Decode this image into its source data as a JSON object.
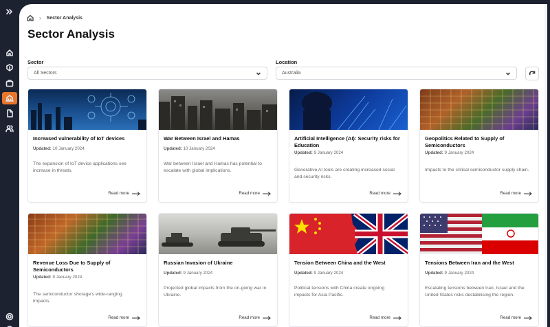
{
  "breadcrumb": {
    "current": "Sector Analysis"
  },
  "page": {
    "title": "Sector Analysis"
  },
  "filters": {
    "sector_label": "Sector",
    "sector_value": "All Sectors",
    "location_label": "Location",
    "location_value": "Australia"
  },
  "sidebar": {
    "icons": [
      "expand-icon",
      "home-icon",
      "alert-icon",
      "briefcase-icon",
      "building-icon",
      "document-icon",
      "users-icon",
      "settings-icon",
      "logout-icon"
    ]
  },
  "colors": {
    "accent": "#e8762c",
    "sidebar": "#1c2230"
  },
  "cards": [
    {
      "title": "Increased vulnerability of IoT devices",
      "updated_label": "Updated:",
      "updated_date": "10 January 2024",
      "description": "The expansion of IoT device applications see increase in threats.",
      "read_more": "Read more"
    },
    {
      "title": "War Between Israel and Hamas",
      "updated_label": "Updated:",
      "updated_date": "10 January 2024",
      "description": "War between Israel and Hamas has potential to escalate with global implications.",
      "read_more": "Read more"
    },
    {
      "title": "Artificial Intelligence (AI): Security risks for Education",
      "updated_label": "Updated:",
      "updated_date": "9 January 2024",
      "description": "Generative AI tools are creating increased social and security risks.",
      "read_more": "Read more"
    },
    {
      "title": "Geopolitics Related to Supply of Semiconductors",
      "updated_label": "Updated:",
      "updated_date": "9 January 2024",
      "description": "Impacts to the critical semiconductor supply chain.",
      "read_more": "Read more"
    },
    {
      "title": "Revenue Loss Due to Supply of Semiconductors",
      "updated_label": "Updated:",
      "updated_date": "9 January 2024",
      "description": "The semiconductor shorage's wide-ranging impacts.",
      "read_more": "Read more"
    },
    {
      "title": "Russian Invasion of Ukraine",
      "updated_label": "Updated:",
      "updated_date": "9 January 2024",
      "description": "Projected global impacts from the on-going war in Ukraine.",
      "read_more": "Read more"
    },
    {
      "title": "Tension Between China and the West",
      "updated_label": "Updated:",
      "updated_date": "9 January 2024",
      "description": "Political tensions with China create ongoing impacts for Asia Pacific.",
      "read_more": "Read more"
    },
    {
      "title": "Tensions Between Iran and the West",
      "updated_label": "Updated:",
      "updated_date": "9 January 2024",
      "description": "Escalating tensions between Iran, Israel and the United States risks destabilising the region.",
      "read_more": "Read more"
    }
  ]
}
